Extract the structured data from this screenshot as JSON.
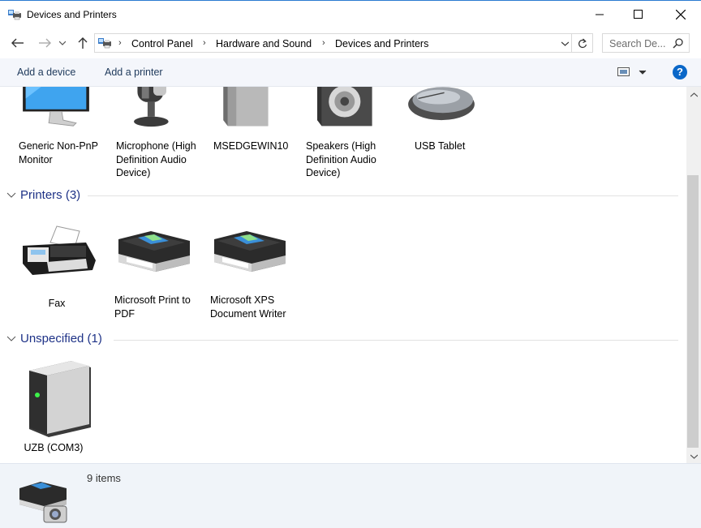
{
  "window": {
    "title": "Devices and Printers",
    "minimize": "–",
    "maximize": "☐",
    "close": "✕"
  },
  "nav": {
    "back": "←",
    "forward": "→",
    "recent": "˅",
    "up": "↑",
    "breadcrumb": [
      "Control Panel",
      "Hardware and Sound",
      "Devices and Printers"
    ],
    "separator": "›",
    "dropdown": "˅",
    "refresh": "↻",
    "search_placeholder": "Search De..."
  },
  "toolbar": {
    "add_device": "Add a device",
    "add_printer": "Add a printer",
    "help": "?"
  },
  "devices": [
    {
      "label": "Generic Non-PnP Monitor",
      "icon": "monitor-icon"
    },
    {
      "label": "Microphone (High Definition Audio Device)",
      "icon": "microphone-icon"
    },
    {
      "label": "MSEDGEWIN10",
      "icon": "computer-tower-icon"
    },
    {
      "label": "Speakers (High Definition Audio Device)",
      "icon": "speaker-icon"
    },
    {
      "label": "USB Tablet",
      "icon": "mouse-icon"
    }
  ],
  "printers": {
    "header": "Printers (3)",
    "items": [
      {
        "label": "Fax",
        "icon": "fax-icon"
      },
      {
        "label": "Microsoft Print to PDF",
        "icon": "printer-icon"
      },
      {
        "label": "Microsoft XPS Document Writer",
        "icon": "printer-icon"
      }
    ]
  },
  "unspecified": {
    "header": "Unspecified (1)",
    "items": [
      {
        "label": "UZB (COM3)",
        "icon": "drive-unit-icon"
      }
    ]
  },
  "details": {
    "count": "9 items"
  },
  "colors": {
    "accent": "#1e3287",
    "cmdbar_bg": "#f4f6fb",
    "details_bg": "#f0f4f9",
    "help": "#0a67c8"
  }
}
